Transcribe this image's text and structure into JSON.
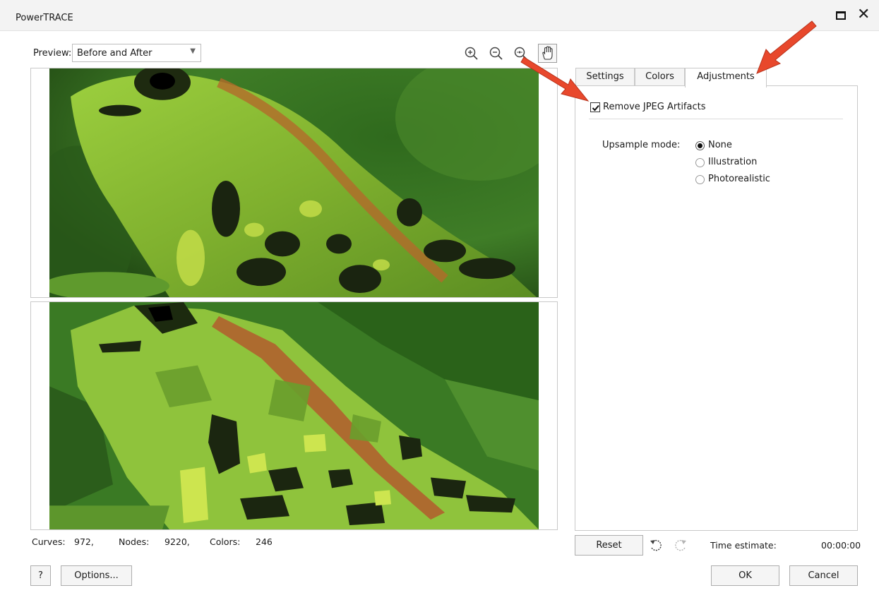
{
  "window": {
    "title": "PowerTRACE"
  },
  "preview": {
    "label": "Preview:",
    "selected": "Before and After"
  },
  "tools": {
    "zoom_in": "zoom-in-icon",
    "zoom_out": "zoom-out-icon",
    "zoom_fit": "zoom-fit-icon",
    "pan": "hand-icon"
  },
  "stats": {
    "curves_label": "Curves:",
    "curves_value": "972,",
    "nodes_label": "Nodes:",
    "nodes_value": "9220,",
    "colors_label": "Colors:",
    "colors_value": "246"
  },
  "tabs": [
    {
      "label": "Settings",
      "active": false
    },
    {
      "label": "Colors",
      "active": false
    },
    {
      "label": "Adjustments",
      "active": true
    }
  ],
  "adjustments": {
    "remove_jpeg_label": "Remove JPEG Artifacts",
    "remove_jpeg_checked": true,
    "upsample_label": "Upsample mode:",
    "upsample_options": [
      {
        "label": "None",
        "selected": true
      },
      {
        "label": "Illustration",
        "selected": false
      },
      {
        "label": "Photorealistic",
        "selected": false
      }
    ]
  },
  "footer": {
    "reset_label": "Reset",
    "time_estimate_label": "Time estimate:",
    "time_estimate_value": "00:00:00",
    "help_label": "?",
    "options_label": "Options...",
    "ok_label": "OK",
    "cancel_label": "Cancel"
  },
  "colors": {
    "annotation_arrow": "#e8482c",
    "frog_green": "#8cc43a",
    "background_green": "#3f7d27"
  }
}
